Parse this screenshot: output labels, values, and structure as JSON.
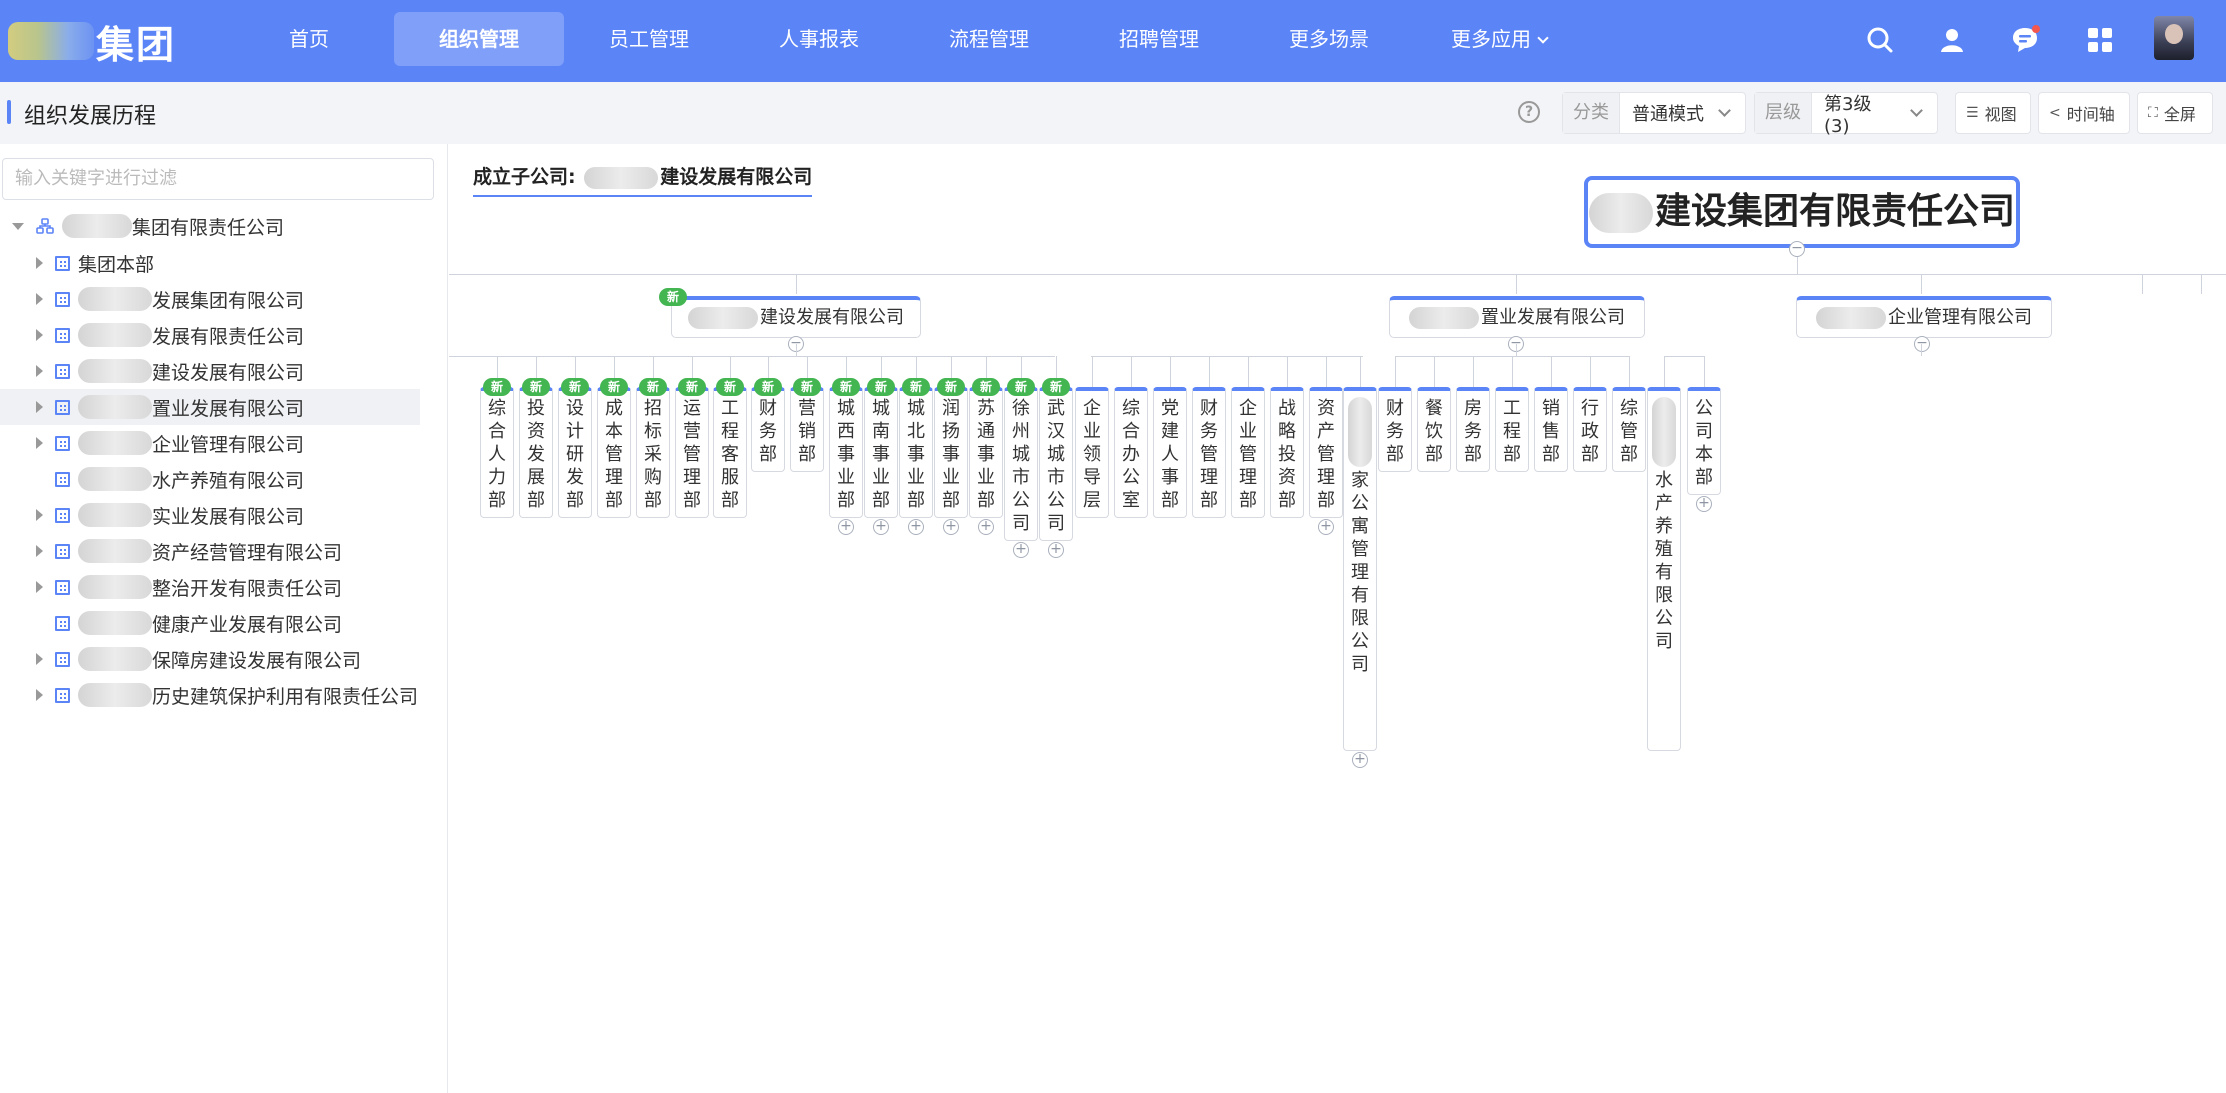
{
  "nav": {
    "brand": "集团",
    "items": [
      {
        "label": "首页",
        "active": false
      },
      {
        "label": "组织管理",
        "active": true
      },
      {
        "label": "员工管理",
        "active": false
      },
      {
        "label": "人事报表",
        "active": false
      },
      {
        "label": "流程管理",
        "active": false
      },
      {
        "label": "招聘管理",
        "active": false
      },
      {
        "label": "更多场景",
        "active": false
      },
      {
        "label": "更多应用",
        "active": false,
        "dropdown": true
      }
    ],
    "icons": [
      "search-icon",
      "user-icon",
      "message-icon",
      "apps-grid-icon",
      "avatar"
    ],
    "accent": "#5b84f7"
  },
  "subheader": {
    "title": "组织发展历程",
    "category_label": "分类",
    "category_value": "普通模式",
    "level_label": "层级",
    "level_value": "第3级 (3)",
    "view_label": "视图",
    "timeline_label": "时间轴",
    "fullscreen_label": "全屏"
  },
  "sidebar": {
    "search_placeholder": "输入关键字进行过滤",
    "tree": [
      {
        "label": "集团有限责任公司",
        "expanded": true,
        "root": true
      },
      {
        "label": "集团本部"
      },
      {
        "label": "发展集团有限公司"
      },
      {
        "label": "发展有限责任公司"
      },
      {
        "label": "建设发展有限公司"
      },
      {
        "label": "置业发展有限公司",
        "selected": true
      },
      {
        "label": "企业管理有限公司"
      },
      {
        "label": "水产养殖有限公司",
        "leaf": true
      },
      {
        "label": "实业发展有限公司"
      },
      {
        "label": "资产经营管理有限公司"
      },
      {
        "label": "整治开发有限责任公司"
      },
      {
        "label": "健康产业发展有限公司",
        "leaf": true
      },
      {
        "label": "保障房建设发展有限公司"
      },
      {
        "label": "历史建筑保护利用有限责任公司"
      }
    ]
  },
  "chart": {
    "crumb_prefix": "成立子公司:",
    "crumb_name": "建设发展有限公司",
    "new_badge": "新",
    "root": "建设集团有限责任公司",
    "l1": [
      {
        "label": "建设发展有限公司",
        "is_new": true
      },
      {
        "label": "置业发展有限公司"
      },
      {
        "label": "企业管理有限公司"
      }
    ],
    "depts": [
      {
        "label": "综合人力部",
        "new": true
      },
      {
        "label": "投资发展部",
        "new": true
      },
      {
        "label": "设计研发部",
        "new": true
      },
      {
        "label": "成本管理部",
        "new": true
      },
      {
        "label": "招标采购部",
        "new": true
      },
      {
        "label": "运营管理部",
        "new": true
      },
      {
        "label": "工程客服部",
        "new": true
      },
      {
        "label": "财务部",
        "new": true
      },
      {
        "label": "营销部",
        "new": true
      },
      {
        "label": "城西事业部",
        "new": true
      },
      {
        "label": "城南事业部",
        "new": true
      },
      {
        "label": "城北事业部",
        "new": true
      },
      {
        "label": "润扬事业部",
        "new": true
      },
      {
        "label": "苏通事业部",
        "new": true
      },
      {
        "label": "徐州城市公司",
        "new": true
      },
      {
        "label": "武汉城市公司",
        "new": true
      },
      {
        "label": "企业领导层"
      },
      {
        "label": "综合办公室"
      },
      {
        "label": "党建人事部"
      },
      {
        "label": "财务管理部"
      },
      {
        "label": "企业管理部"
      },
      {
        "label": "战略投资部"
      },
      {
        "label": "资产管理部"
      },
      {
        "label": "家公寓管理有限公司"
      },
      {
        "label": "财务部"
      },
      {
        "label": "餐饮部"
      },
      {
        "label": "房务部"
      },
      {
        "label": "工程部"
      },
      {
        "label": "销售部"
      },
      {
        "label": "行政部"
      },
      {
        "label": "综管部"
      },
      {
        "label": "水产养殖有限公司"
      },
      {
        "label": "公司本部"
      }
    ]
  }
}
